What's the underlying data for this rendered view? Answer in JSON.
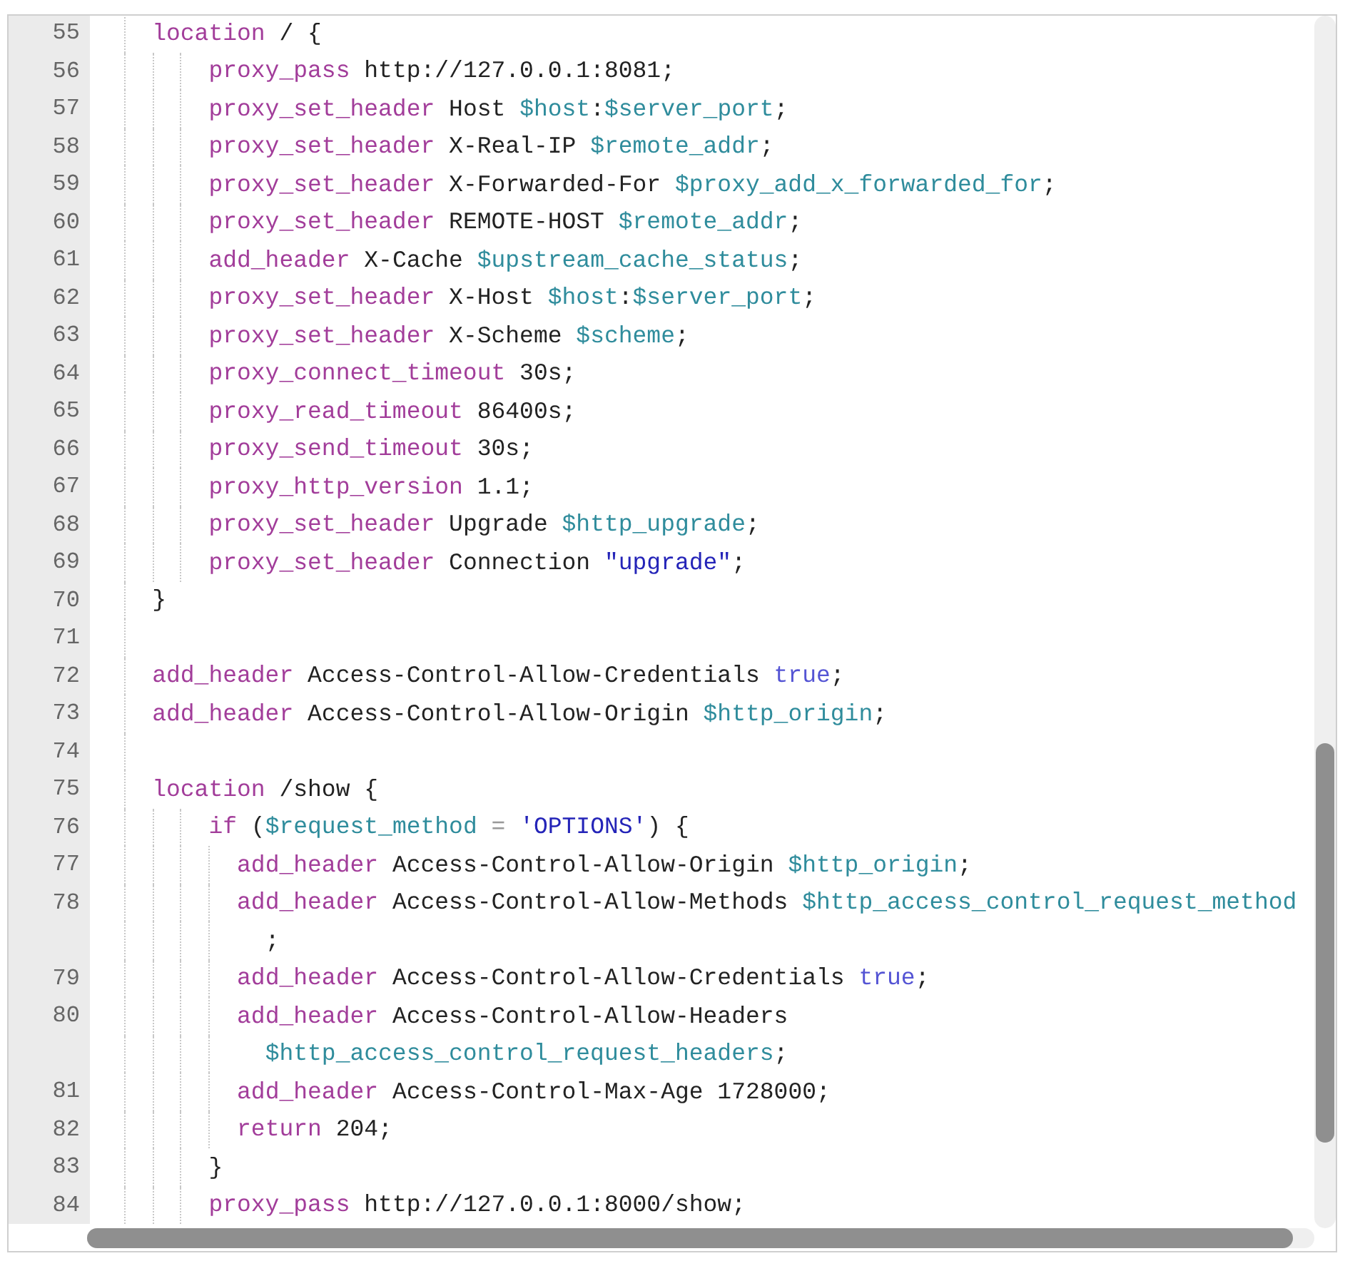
{
  "editor": {
    "lines": [
      {
        "number": "55",
        "tokens": [
          {
            "kind": "keyword",
            "text": "location"
          },
          {
            "kind": "plain",
            "text": " / {"
          }
        ],
        "children": [
          {
            "number": "56",
            "tokens": [
              {
                "kind": "keyword",
                "text": "proxy_pass"
              },
              {
                "kind": "plain",
                "text": " http://127.0.0.1:8081;"
              }
            ]
          },
          {
            "number": "57",
            "tokens": [
              {
                "kind": "keyword",
                "text": "proxy_set_header"
              },
              {
                "kind": "plain",
                "text": " Host "
              },
              {
                "kind": "variable",
                "text": "$host"
              },
              {
                "kind": "plain",
                "text": ":"
              },
              {
                "kind": "variable",
                "text": "$server_port"
              },
              {
                "kind": "plain",
                "text": ";"
              }
            ]
          },
          {
            "number": "58",
            "tokens": [
              {
                "kind": "keyword",
                "text": "proxy_set_header"
              },
              {
                "kind": "plain",
                "text": " X-Real-IP "
              },
              {
                "kind": "variable",
                "text": "$remote_addr"
              },
              {
                "kind": "plain",
                "text": ";"
              }
            ]
          },
          {
            "number": "59",
            "tokens": [
              {
                "kind": "keyword",
                "text": "proxy_set_header"
              },
              {
                "kind": "plain",
                "text": " X-Forwarded-For "
              },
              {
                "kind": "variable",
                "text": "$proxy_add_x_forwarded_for"
              },
              {
                "kind": "plain",
                "text": ";"
              }
            ]
          },
          {
            "number": "60",
            "tokens": [
              {
                "kind": "keyword",
                "text": "proxy_set_header"
              },
              {
                "kind": "plain",
                "text": " REMOTE-HOST "
              },
              {
                "kind": "variable",
                "text": "$remote_addr"
              },
              {
                "kind": "plain",
                "text": ";"
              }
            ]
          },
          {
            "number": "61",
            "tokens": [
              {
                "kind": "keyword",
                "text": "add_header"
              },
              {
                "kind": "plain",
                "text": " X-Cache "
              },
              {
                "kind": "variable",
                "text": "$upstream_cache_status"
              },
              {
                "kind": "plain",
                "text": ";"
              }
            ]
          },
          {
            "number": "62",
            "tokens": [
              {
                "kind": "keyword",
                "text": "proxy_set_header"
              },
              {
                "kind": "plain",
                "text": " X-Host "
              },
              {
                "kind": "variable",
                "text": "$host"
              },
              {
                "kind": "plain",
                "text": ":"
              },
              {
                "kind": "variable",
                "text": "$server_port"
              },
              {
                "kind": "plain",
                "text": ";"
              }
            ]
          },
          {
            "number": "63",
            "tokens": [
              {
                "kind": "keyword",
                "text": "proxy_set_header"
              },
              {
                "kind": "plain",
                "text": " X-Scheme "
              },
              {
                "kind": "variable",
                "text": "$scheme"
              },
              {
                "kind": "plain",
                "text": ";"
              }
            ]
          },
          {
            "number": "64",
            "tokens": [
              {
                "kind": "keyword",
                "text": "proxy_connect_timeout"
              },
              {
                "kind": "plain",
                "text": " 30s;"
              }
            ]
          },
          {
            "number": "65",
            "tokens": [
              {
                "kind": "keyword",
                "text": "proxy_read_timeout"
              },
              {
                "kind": "plain",
                "text": " 86400s;"
              }
            ]
          },
          {
            "number": "66",
            "tokens": [
              {
                "kind": "keyword",
                "text": "proxy_send_timeout"
              },
              {
                "kind": "plain",
                "text": " 30s;"
              }
            ]
          },
          {
            "number": "67",
            "tokens": [
              {
                "kind": "keyword",
                "text": "proxy_http_version"
              },
              {
                "kind": "plain",
                "text": " 1.1;"
              }
            ]
          },
          {
            "number": "68",
            "tokens": [
              {
                "kind": "keyword",
                "text": "proxy_set_header"
              },
              {
                "kind": "plain",
                "text": " Upgrade "
              },
              {
                "kind": "variable",
                "text": "$http_upgrade"
              },
              {
                "kind": "plain",
                "text": ";"
              }
            ]
          },
          {
            "number": "69",
            "tokens": [
              {
                "kind": "keyword",
                "text": "proxy_set_header"
              },
              {
                "kind": "plain",
                "text": " Connection "
              },
              {
                "kind": "string",
                "text": "\"upgrade\""
              },
              {
                "kind": "plain",
                "text": ";"
              }
            ]
          }
        ]
      },
      {
        "number": "70",
        "tokens": [
          {
            "kind": "plain",
            "text": "}"
          }
        ]
      },
      {
        "number": "71"
      },
      {
        "number": "72",
        "tokens": [
          {
            "kind": "keyword",
            "text": "add_header"
          },
          {
            "kind": "plain",
            "text": " Access-Control-Allow-Credentials "
          },
          {
            "kind": "atom",
            "text": "true"
          },
          {
            "kind": "plain",
            "text": ";"
          }
        ]
      },
      {
        "number": "73",
        "tokens": [
          {
            "kind": "keyword",
            "text": "add_header"
          },
          {
            "kind": "plain",
            "text": " Access-Control-Allow-Origin "
          },
          {
            "kind": "variable",
            "text": "$http_origin"
          },
          {
            "kind": "plain",
            "text": ";"
          }
        ]
      },
      {
        "number": "74"
      },
      {
        "number": "75",
        "tokens": [
          {
            "kind": "keyword",
            "text": "location"
          },
          {
            "kind": "plain",
            "text": " /show {"
          }
        ],
        "children": [
          {
            "number": "76",
            "tokens": [
              {
                "kind": "keyword",
                "text": "if"
              },
              {
                "kind": "plain",
                "text": " ("
              },
              {
                "kind": "variable",
                "text": "$request_method"
              },
              {
                "kind": "operator",
                "text": " = "
              },
              {
                "kind": "string",
                "text": "'OPTIONS'"
              },
              {
                "kind": "plain",
                "text": ") {"
              }
            ],
            "children": [
              {
                "number": "77",
                "tokens": [
                  {
                    "kind": "keyword",
                    "text": "add_header"
                  },
                  {
                    "kind": "plain",
                    "text": " Access-Control-Allow-Origin "
                  },
                  {
                    "kind": "variable",
                    "text": "$http_origin"
                  },
                  {
                    "kind": "plain",
                    "text": ";"
                  }
                ]
              },
              {
                "number": "78",
                "tokens": [
                  {
                    "kind": "keyword",
                    "text": "add_header"
                  },
                  {
                    "kind": "plain",
                    "text": " Access-Control-Allow-Methods "
                  },
                  {
                    "kind": "variable",
                    "text": "$http_access_control_request_method"
                  }
                ],
                "continuation": [
                  {
                    "kind": "plain",
                    "text": ";"
                  }
                ]
              },
              {
                "number": "79",
                "tokens": [
                  {
                    "kind": "keyword",
                    "text": "add_header"
                  },
                  {
                    "kind": "plain",
                    "text": " Access-Control-Allow-Credentials "
                  },
                  {
                    "kind": "atom",
                    "text": "true"
                  },
                  {
                    "kind": "plain",
                    "text": ";"
                  }
                ]
              },
              {
                "number": "80",
                "tokens": [
                  {
                    "kind": "keyword",
                    "text": "add_header"
                  },
                  {
                    "kind": "plain",
                    "text": " Access-Control-Allow-Headers"
                  }
                ],
                "continuation": [
                  {
                    "kind": "variable",
                    "text": "$http_access_control_request_headers"
                  },
                  {
                    "kind": "plain",
                    "text": ";"
                  }
                ]
              },
              {
                "number": "81",
                "tokens": [
                  {
                    "kind": "keyword",
                    "text": "add_header"
                  },
                  {
                    "kind": "plain",
                    "text": " Access-Control-Max-Age 1728000;"
                  }
                ]
              },
              {
                "number": "82",
                "tokens": [
                  {
                    "kind": "keyword",
                    "text": "return"
                  },
                  {
                    "kind": "plain",
                    "text": " 204;"
                  }
                ]
              }
            ]
          },
          {
            "number": "83",
            "tokens": [
              {
                "kind": "plain",
                "text": "}"
              }
            ]
          },
          {
            "number": "84",
            "tokens": [
              {
                "kind": "keyword",
                "text": "proxy_pass"
              },
              {
                "kind": "plain",
                "text": " http://127.0.0.1:8000/show;"
              }
            ]
          }
        ]
      }
    ]
  }
}
